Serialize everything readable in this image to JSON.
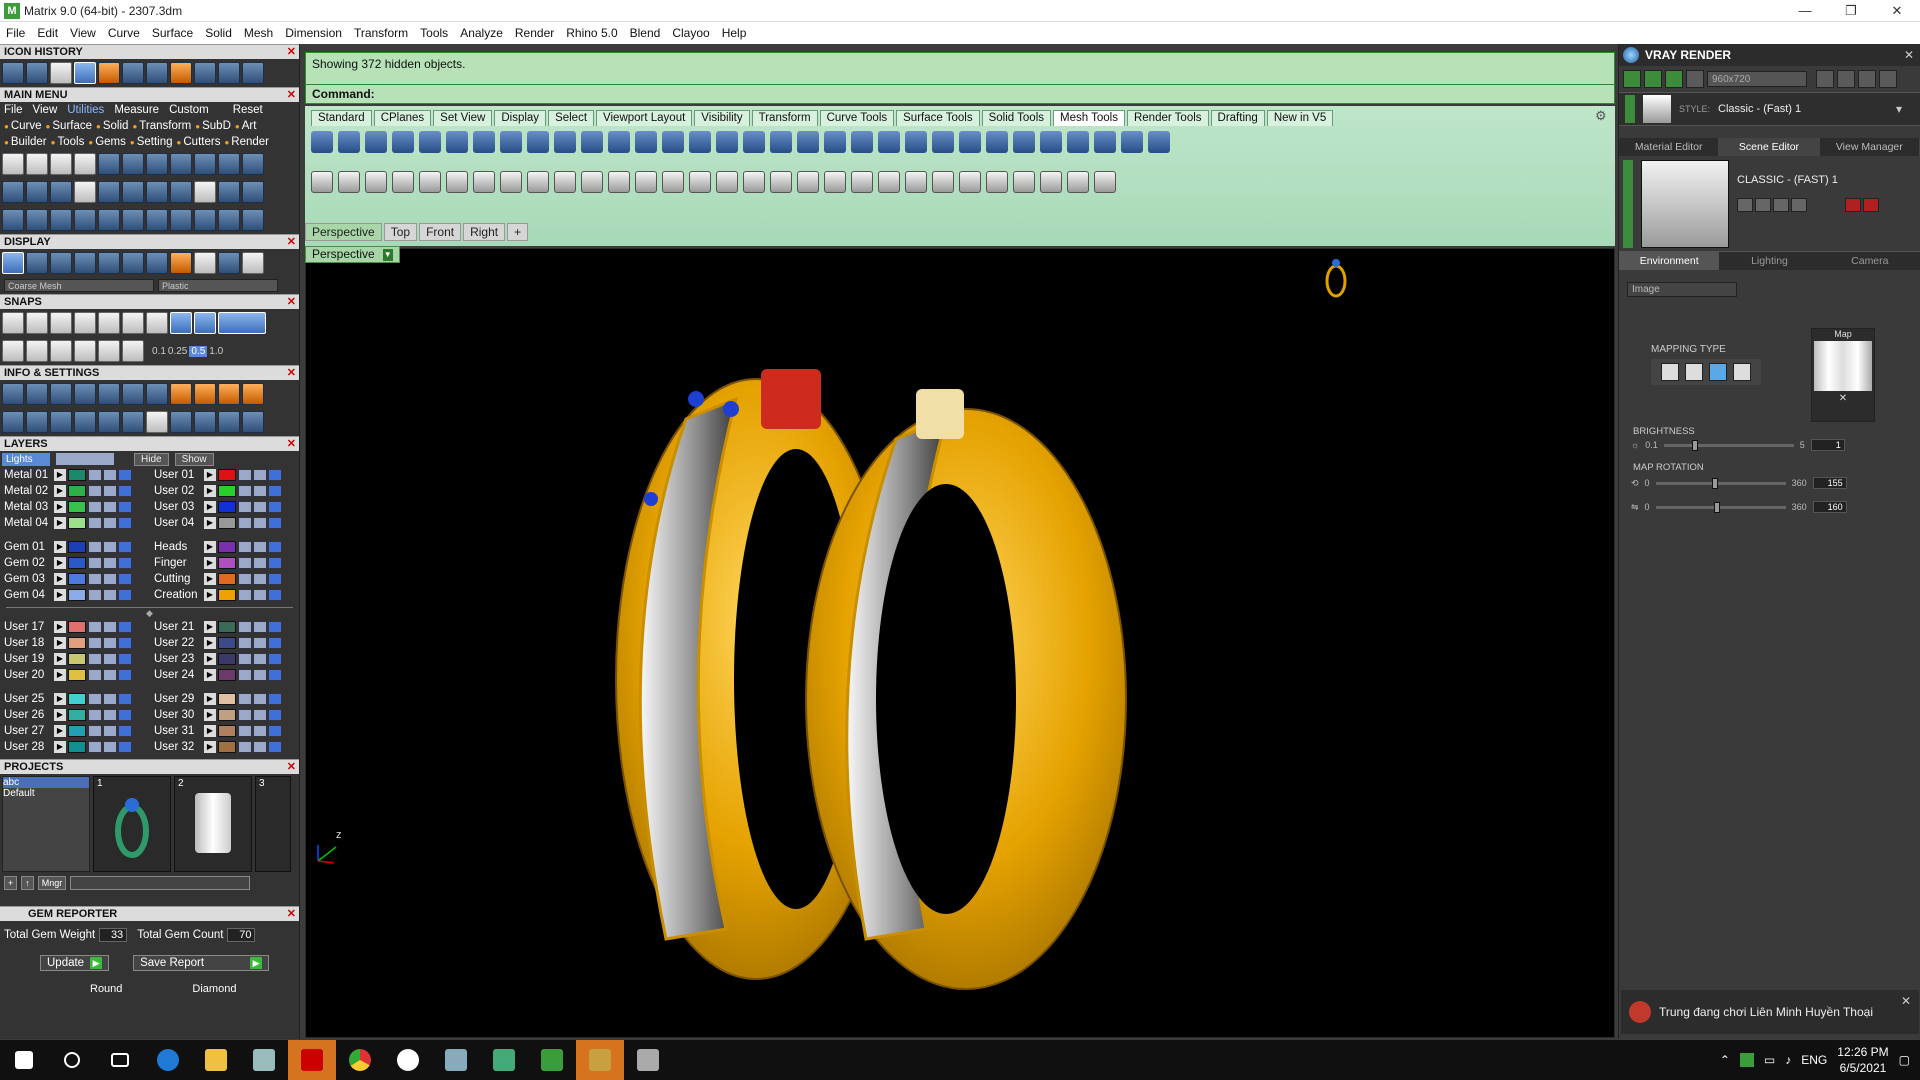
{
  "window": {
    "title": "Matrix 9.0 (64-bit) - 2307.3dm",
    "controls": [
      "—",
      "❐",
      "✕"
    ]
  },
  "menubar": [
    "File",
    "Edit",
    "View",
    "Curve",
    "Surface",
    "Solid",
    "Mesh",
    "Dimension",
    "Transform",
    "Tools",
    "Analyze",
    "Render",
    "Rhino 5.0",
    "Blend",
    "Clayoo",
    "Help"
  ],
  "left": {
    "icon_history": "ICON HISTORY",
    "main_menu": "MAIN MENU",
    "mm_top": [
      "File",
      "View",
      "Utilities",
      "Measure",
      "Custom",
      "Reset"
    ],
    "mm_row1": [
      "Curve",
      "Surface",
      "Solid",
      "Transform",
      "SubD",
      "Art"
    ],
    "mm_row2": [
      "Builder",
      "Tools",
      "Gems",
      "Setting",
      "Cutters",
      "Render"
    ],
    "display": "DISPLAY",
    "display_dd": [
      "Coarse Mesh",
      "Plastic"
    ],
    "snaps": "SNAPS",
    "snap_vals": [
      "0.1",
      "0.25",
      "0.5",
      "1.0"
    ],
    "info": "INFO & SETTINGS",
    "layers": "LAYERS",
    "layers_head": {
      "lights": "Lights",
      "hide": "Hide",
      "show": "Show"
    },
    "layer_group1_left": [
      "Metal 01",
      "Metal 02",
      "Metal 03",
      "Metal 04"
    ],
    "layer_group1_right": [
      "User 01",
      "User 02",
      "User 03",
      "User 04"
    ],
    "layer_group2_left": [
      "Gem 01",
      "Gem 02",
      "Gem 03",
      "Gem 04"
    ],
    "layer_group2_right": [
      "Heads",
      "Finger",
      "Cutting",
      "Creation"
    ],
    "layer_group3_left": [
      "User 17",
      "User 18",
      "User 19",
      "User 20"
    ],
    "layer_group3_right": [
      "User 21",
      "User 22",
      "User 23",
      "User 24"
    ],
    "layer_group4_left": [
      "User 25",
      "User 26",
      "User 27",
      "User 28"
    ],
    "layer_group4_right": [
      "User 29",
      "User 30",
      "User 31",
      "User 32"
    ],
    "projects": "PROJECTS",
    "project_list": [
      "abc",
      "Default"
    ],
    "project_slots": [
      "1",
      "2",
      "3"
    ],
    "proj_mngr": "Mngr",
    "gem_reporter": "GEM REPORTER",
    "total_gem_weight_label": "Total Gem Weight",
    "total_gem_weight": "33",
    "total_gem_count_label": "Total Gem Count",
    "total_gem_count": "70",
    "update": "Update",
    "save_report": "Save Report",
    "round": "Round",
    "diamond": "Diamond"
  },
  "center": {
    "history_text": "Showing 372 hidden objects.",
    "command_label": "Command:",
    "toolbar_tabs": [
      "Standard",
      "CPlanes",
      "Set View",
      "Display",
      "Select",
      "Viewport Layout",
      "Visibility",
      "Transform",
      "Curve Tools",
      "Surface Tools",
      "Solid Tools",
      "Mesh Tools",
      "Render Tools",
      "Drafting",
      "New in V5"
    ],
    "active_tab": "Mesh Tools",
    "viewport_tabs": [
      "Perspective",
      "Top",
      "Front",
      "Right",
      "+"
    ],
    "viewport_label": "Perspective",
    "axis_z": "z"
  },
  "right": {
    "title": "VRAY RENDER",
    "resolution": "960x720",
    "style_label": "STYLE:",
    "style_value": "Classic - (Fast) 1",
    "tabs": [
      "Material Editor",
      "Scene Editor",
      "View Manager"
    ],
    "scene_name": "CLASSIC - (FAST) 1",
    "subtabs": [
      "Environment",
      "Lighting",
      "Camera"
    ],
    "env_type": "Image",
    "mapping_type": "MAPPING TYPE",
    "map_label": "Map",
    "brightness": "BRIGHTNESS",
    "brightness_min": "0.1",
    "brightness_max": "5",
    "brightness_val": "1",
    "map_rotation": "MAP ROTATION",
    "rot_min": "0",
    "rot_max": "360",
    "rot1": "155",
    "rot2": "160"
  },
  "notification": "Trung đang chơi Liên Minh Huyền Thoại",
  "taskbar": {
    "lang": "ENG",
    "time": "12:26 PM",
    "date": "6/5/2021"
  },
  "colors": {
    "viewport_bg": "#000000",
    "gold": "#e0a000",
    "history_green": "#b7e2b7"
  }
}
